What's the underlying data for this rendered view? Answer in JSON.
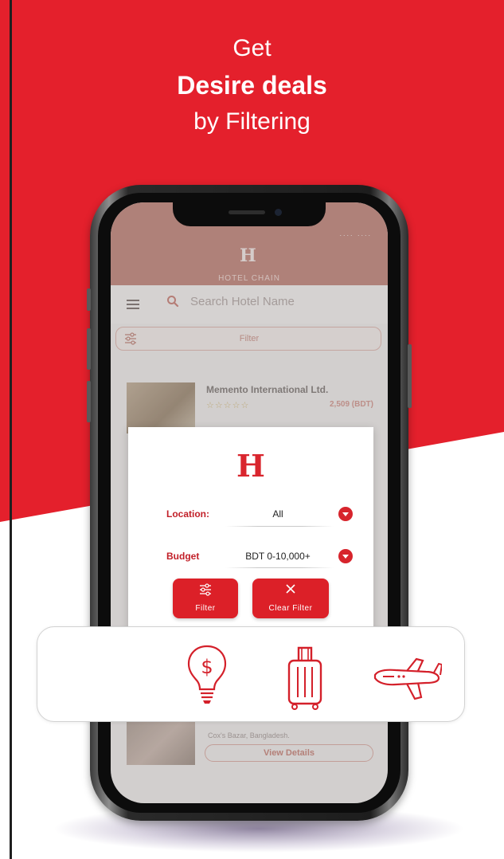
{
  "headline": {
    "line1": "Get",
    "line2": "Desire deals",
    "line3": "by Filtering"
  },
  "colors": {
    "brand_red": "#e4202c",
    "dark_red": "#c22029",
    "faded_header": "#c89187"
  },
  "app": {
    "brand_mark": "H",
    "brand_name": "HOTEL CHAIN",
    "status": "....  ....",
    "search": {
      "placeholder": "Search Hotel Name",
      "icon": "search-icon"
    },
    "menu_icon": "hamburger-icon",
    "filter_bar_label": "Filter",
    "hotel_card": {
      "name": "Memento International Ltd.",
      "stars": "☆☆☆☆☆",
      "price": "2,509 (BDT)"
    },
    "hotel_card_2": {
      "address": "Cox's Bazar, Bangladesh.",
      "button": "View Details"
    }
  },
  "filter_modal": {
    "logo": "H",
    "location": {
      "label": "Location:",
      "value": "All"
    },
    "budget": {
      "label": "Budget",
      "value": "BDT 0-10,000+"
    },
    "filter_button": {
      "label": "Filter",
      "icon": "sliders-icon"
    },
    "clear_button": {
      "label": "Clear Filter",
      "icon": "close-icon"
    }
  },
  "features": [
    {
      "icon": "lightbulb-dollar-icon"
    },
    {
      "icon": "luggage-icon"
    },
    {
      "icon": "airplane-icon"
    }
  ]
}
